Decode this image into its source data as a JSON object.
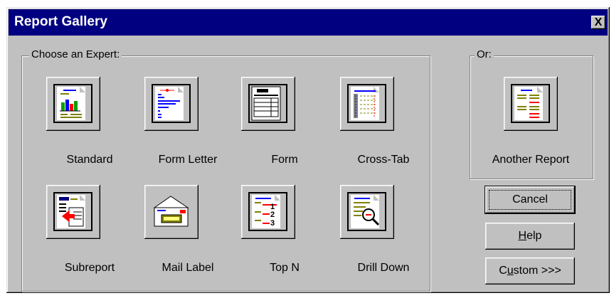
{
  "window": {
    "title": "Report Gallery",
    "close_glyph": "X"
  },
  "expert_group": {
    "legend": "Choose an Expert:",
    "items": [
      {
        "label": "Standard",
        "icon": "standard-report-icon"
      },
      {
        "label": "Form Letter",
        "icon": "form-letter-icon"
      },
      {
        "label": "Form",
        "icon": "form-icon"
      },
      {
        "label": "Cross-Tab",
        "icon": "cross-tab-icon"
      },
      {
        "label": "Subreport",
        "icon": "subreport-icon"
      },
      {
        "label": "Mail Label",
        "icon": "mail-label-icon"
      },
      {
        "label": "Top N",
        "icon": "top-n-icon"
      },
      {
        "label": "Drill Down",
        "icon": "drill-down-icon"
      }
    ]
  },
  "or_group": {
    "legend": "Or:",
    "item": {
      "label": "Another Report",
      "icon": "another-report-icon"
    }
  },
  "buttons": {
    "cancel": "Cancel",
    "help_mnemonic": "H",
    "help_rest": "elp",
    "custom_first": "C",
    "custom_mnemonic": "u",
    "custom_rest": "stom >>>"
  },
  "colors": {
    "title_bar": "#000080",
    "dialog_face": "#c0c0c0",
    "accent_red": "#ff0000",
    "accent_blue": "#0000ff",
    "accent_olive": "#808000"
  }
}
